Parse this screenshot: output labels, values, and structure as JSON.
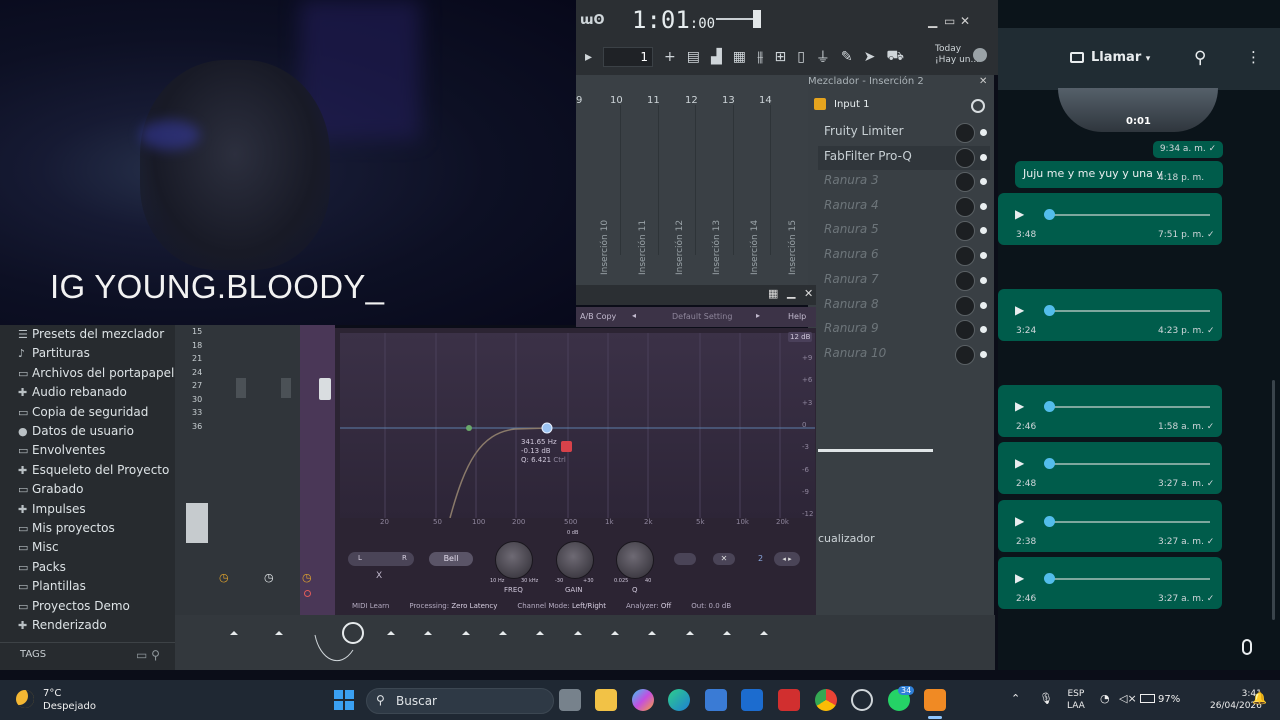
{
  "overlay": {
    "ig_handle": "IG YOUNG.BLOODY_"
  },
  "fl_top": {
    "logo": "ɯʘ",
    "time_main": "1:01",
    "time_sub": ":00",
    "pattern_number": "1",
    "news": [
      "Today",
      "¡Hay un..."
    ]
  },
  "mixer": {
    "track_numbers": [
      "9",
      "10",
      "11",
      "12",
      "13",
      "14"
    ],
    "strip_labels": [
      "Inserción 10",
      "Inserción 11",
      "Inserción 12",
      "Inserción 13",
      "Inserción 14",
      "Inserción 15"
    ]
  },
  "insert_panel": {
    "title": "Mezclador - Inserción 2",
    "input": "Input 1",
    "slots": [
      {
        "label": "Fruity Limiter",
        "state": "filled"
      },
      {
        "label": "FabFilter Pro-Q",
        "state": "selected"
      },
      {
        "label": "Ranura 3",
        "state": "empty"
      },
      {
        "label": "Ranura 4",
        "state": "empty"
      },
      {
        "label": "Ranura 5",
        "state": "empty"
      },
      {
        "label": "Ranura 6",
        "state": "empty"
      },
      {
        "label": "Ranura 7",
        "state": "empty"
      },
      {
        "label": "Ranura 8",
        "state": "empty"
      },
      {
        "label": "Ranura 9",
        "state": "empty"
      },
      {
        "label": "Ranura 10",
        "state": "empty"
      }
    ],
    "eq_label": "cualizador"
  },
  "browser": {
    "items": [
      {
        "icon": "☰",
        "label": "Presets del mezclador"
      },
      {
        "icon": "♪",
        "label": "Partituras"
      },
      {
        "icon": "▭",
        "label": "Archivos del portapapeles"
      },
      {
        "icon": "✚",
        "label": "Audio rebanado"
      },
      {
        "icon": "▭",
        "label": "Copia de seguridad"
      },
      {
        "icon": "●",
        "label": "Datos de usuario"
      },
      {
        "icon": "▭",
        "label": "Envolventes"
      },
      {
        "icon": "✚",
        "label": "Esqueleto del Proyecto"
      },
      {
        "icon": "▭",
        "label": "Grabado"
      },
      {
        "icon": "✚",
        "label": "Impulses"
      },
      {
        "icon": "▭",
        "label": "Mis proyectos"
      },
      {
        "icon": "▭",
        "label": "Misc"
      },
      {
        "icon": "▭",
        "label": "Packs"
      },
      {
        "icon": "▭",
        "label": "Plantillas"
      },
      {
        "icon": "▭",
        "label": "Proyectos Demo"
      },
      {
        "icon": "✚",
        "label": "Renderizado"
      }
    ],
    "tags_label": "TAGS"
  },
  "strip_db": [
    "15",
    "18",
    "21",
    "24",
    "27",
    "30",
    "33",
    "36"
  ],
  "fabfilter": {
    "toolbar": {
      "ab": "A/B",
      "copy": "Copy",
      "preset": "Default Setting",
      "help": "Help"
    },
    "range": "12 dB",
    "freq_ticks": [
      "20",
      "50",
      "100",
      "200",
      "500",
      "1k",
      "2k",
      "5k",
      "10k",
      "20k"
    ],
    "db_ticks": [
      "+9",
      "+6",
      "+3",
      "0",
      "-3",
      "-6",
      "-9",
      "-12"
    ],
    "band": {
      "shape": "Bell",
      "slope_l": "L",
      "slope_r": "R",
      "index": "2"
    },
    "tooltip": {
      "freq": "341.65 Hz",
      "gain": "-0.13 dB",
      "q": "Q: 6.421",
      "hint": "Ctrl"
    },
    "knobs": {
      "freq": {
        "label": "FREQ",
        "min": "10 Hz",
        "max": "30 kHz"
      },
      "gain": {
        "label": "GAIN",
        "top": "0 dB",
        "min": "-30",
        "max": "+30"
      },
      "q": {
        "label": "Q",
        "min": "0.025",
        "max": "40"
      }
    },
    "status": {
      "midi": "MIDI Learn",
      "processing_label": "Processing:",
      "processing": "Zero Latency",
      "channel_label": "Channel Mode:",
      "channel": "Left/Right",
      "analyzer_label": "Analyzer:",
      "analyzer": "Off",
      "out": "Out: 0.0 dB"
    }
  },
  "whatsapp": {
    "call_label": "Llamar",
    "video_time": "0:01",
    "text_message": {
      "time": "9:34 a. m.",
      "text": "Juju me y me yuy y una y",
      "text_time": "4:18 p. m."
    },
    "voice_messages": [
      {
        "duration": "3:48",
        "time": "7:51 p. m."
      },
      {
        "duration": "3:24",
        "time": "4:23 p. m."
      },
      {
        "duration": "2:46",
        "time": "1:58 a. m."
      },
      {
        "duration": "2:48",
        "time": "3:27 a. m."
      },
      {
        "duration": "2:38",
        "time": "3:27 a. m."
      },
      {
        "duration": "2:46",
        "time": "3:27 a. m."
      }
    ]
  },
  "taskbar": {
    "temp": "7°C",
    "weather": "Despejado",
    "search_placeholder": "Buscar",
    "badge": "34",
    "lang": [
      "ESP",
      "LAA"
    ],
    "battery": "97%",
    "time": "3:41",
    "date": "26/04/2026"
  },
  "colors": {
    "wa_bubble": "#005c4b",
    "wa_accent": "#53bdeb",
    "ff_bg": "#2c2433",
    "fl_panel": "#393f44"
  }
}
